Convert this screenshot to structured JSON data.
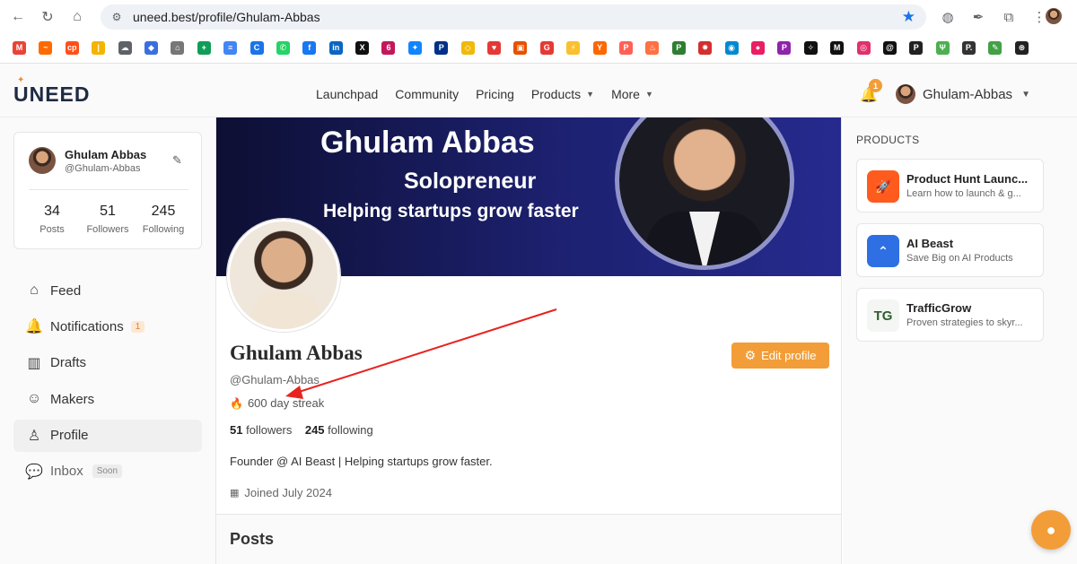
{
  "browser": {
    "url": "uneed.best/profile/Ghulam-Abbas",
    "bookmarks": [
      {
        "icon": "gmail-icon",
        "color": "#ea4335",
        "glyph": "M"
      },
      {
        "icon": "analytics-icon",
        "color": "#ff6a00",
        "glyph": "~"
      },
      {
        "icon": "cp-icon",
        "color": "#ff4f1a",
        "glyph": "cp"
      },
      {
        "icon": "bars-icon",
        "color": "#f4b400",
        "glyph": "|"
      },
      {
        "icon": "cloud-icon",
        "color": "#5f6368",
        "glyph": "☁"
      },
      {
        "icon": "diamond-icon",
        "color": "#3b6fe0",
        "glyph": "◆"
      },
      {
        "icon": "robot-icon",
        "color": "#777777",
        "glyph": "⌂"
      },
      {
        "icon": "sheets-icon",
        "color": "#0f9d58",
        "glyph": "+"
      },
      {
        "icon": "docs-icon",
        "color": "#4285f4",
        "glyph": "≡"
      },
      {
        "icon": "c-icon",
        "color": "#1a73e8",
        "glyph": "C"
      },
      {
        "icon": "whatsapp-icon",
        "color": "#25d366",
        "glyph": "✆"
      },
      {
        "icon": "facebook-icon",
        "color": "#1877f2",
        "glyph": "f"
      },
      {
        "icon": "linkedin-icon",
        "color": "#0a66c2",
        "glyph": "in"
      },
      {
        "icon": "x-icon",
        "color": "#111111",
        "glyph": "X"
      },
      {
        "icon": "663-icon",
        "color": "#c2185b",
        "glyph": "6"
      },
      {
        "icon": "bluesky-icon",
        "color": "#1185fe",
        "glyph": "✦"
      },
      {
        "icon": "paypal-icon",
        "color": "#003087",
        "glyph": "P"
      },
      {
        "icon": "binance-icon",
        "color": "#f0b90b",
        "glyph": "◇"
      },
      {
        "icon": "heart-icon",
        "color": "#e53935",
        "glyph": "♥"
      },
      {
        "icon": "box-icon",
        "color": "#e65100",
        "glyph": "▣"
      },
      {
        "icon": "g-icon",
        "color": "#e53935",
        "glyph": "G"
      },
      {
        "icon": "bolt-icon",
        "color": "#fbc02d",
        "glyph": "⚡"
      },
      {
        "icon": "yc-icon",
        "color": "#ff6600",
        "glyph": "Y"
      },
      {
        "icon": "producthunt-icon",
        "color": "#ff6154",
        "glyph": "P"
      },
      {
        "icon": "fire-icon",
        "color": "#ff7043",
        "glyph": "♨"
      },
      {
        "icon": "p-green-icon",
        "color": "#2e7d32",
        "glyph": "P"
      },
      {
        "icon": "sparkle-icon",
        "color": "#d32f2f",
        "glyph": "✸"
      },
      {
        "icon": "globe-icon",
        "color": "#0288d1",
        "glyph": "◉"
      },
      {
        "icon": "circle-icon",
        "color": "#e91e63",
        "glyph": "●"
      },
      {
        "icon": "patreon-icon",
        "color": "#8e24aa",
        "glyph": "P"
      },
      {
        "icon": "compass-icon",
        "color": "#111111",
        "glyph": "✧"
      },
      {
        "icon": "medium-icon",
        "color": "#111111",
        "glyph": "M"
      },
      {
        "icon": "instagram-icon",
        "color": "#e1306c",
        "glyph": "◎"
      },
      {
        "icon": "threads-icon",
        "color": "#111111",
        "glyph": "@"
      },
      {
        "icon": "page-icon",
        "color": "#222222",
        "glyph": "P"
      },
      {
        "icon": "sprout-icon",
        "color": "#4caf50",
        "glyph": "Ψ"
      },
      {
        "icon": "p-black-icon",
        "color": "#333333",
        "glyph": "P."
      },
      {
        "icon": "leaf-icon",
        "color": "#43a047",
        "glyph": "✎"
      },
      {
        "icon": "github-icon",
        "color": "#222222",
        "glyph": "⊛"
      }
    ]
  },
  "header": {
    "logo": "UNEED",
    "nav": [
      {
        "label": "Launchpad",
        "caret": false
      },
      {
        "label": "Community",
        "caret": false
      },
      {
        "label": "Pricing",
        "caret": false
      },
      {
        "label": "Products",
        "caret": true
      },
      {
        "label": "More",
        "caret": true
      }
    ],
    "notification_count": "1",
    "username": "Ghulam-Abbas"
  },
  "sidebar": {
    "card": {
      "name": "Ghulam Abbas",
      "handle": "@Ghulam-Abbas",
      "stats": [
        {
          "num": "34",
          "label": "Posts"
        },
        {
          "num": "51",
          "label": "Followers"
        },
        {
          "num": "245",
          "label": "Following"
        }
      ]
    },
    "items": [
      {
        "label": "Feed",
        "icon": "home-icon",
        "glyph": "⌂"
      },
      {
        "label": "Notifications",
        "icon": "bell-icon",
        "glyph": "🔔",
        "badge": "1"
      },
      {
        "label": "Drafts",
        "icon": "drafts-icon",
        "glyph": "▥"
      },
      {
        "label": "Makers",
        "icon": "users-icon",
        "glyph": "☺"
      },
      {
        "label": "Profile",
        "icon": "user-icon",
        "glyph": "♙"
      },
      {
        "label": "Inbox",
        "icon": "chat-icon",
        "glyph": "💬",
        "soon": "Soon"
      }
    ]
  },
  "banner": {
    "name": "Ghulam Abbas",
    "role": "Solopreneur",
    "tagline": "Helping startups grow faster"
  },
  "profile": {
    "name": "Ghulam Abbas",
    "handle": "@Ghulam-Abbas",
    "streak": "600 day streak",
    "followers_num": "51",
    "followers_label": "followers",
    "following_num": "245",
    "following_label": "following",
    "bio": "Founder @ AI Beast | Helping startups grow faster.",
    "joined": "Joined July 2024",
    "edit_label": "Edit profile",
    "posts_title": "Posts"
  },
  "right": {
    "title": "PRODUCTS",
    "products": [
      {
        "title": "Product Hunt Launc...",
        "desc": "Learn how to launch & g...",
        "logo_bg": "#ff5b1f",
        "logo_glyph": "🚀"
      },
      {
        "title": "AI Beast",
        "desc": "Save Big on AI Products",
        "logo_bg": "#2f6fe4",
        "logo_glyph": "⌃"
      },
      {
        "title": "TrafficGrow",
        "desc": "Proven strategies to skyr...",
        "logo_bg": "#f3f6f2",
        "logo_glyph": "TG"
      }
    ]
  },
  "colors": {
    "accent": "#f29d38",
    "banner_dark": "#0d0f33",
    "banner_blue": "#262a8e",
    "annotation_arrow": "#e8231f"
  }
}
